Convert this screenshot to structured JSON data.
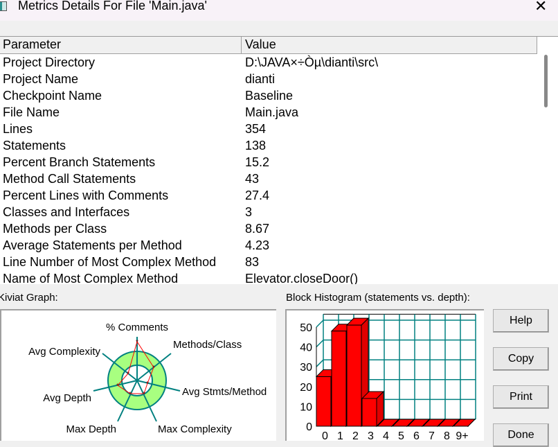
{
  "window": {
    "title": "Metrics Details For File 'Main.java'",
    "close_icon": "close-icon"
  },
  "table": {
    "headers": [
      "Parameter",
      "Value"
    ],
    "rows": [
      {
        "param": "Project Directory",
        "value": "D:\\JAVA×÷Òµ\\dianti\\src\\"
      },
      {
        "param": "Project Name",
        "value": "dianti"
      },
      {
        "param": "Checkpoint Name",
        "value": "Baseline"
      },
      {
        "param": "File Name",
        "value": "Main.java"
      },
      {
        "param": "Lines",
        "value": "354"
      },
      {
        "param": "Statements",
        "value": "138"
      },
      {
        "param": "Percent Branch Statements",
        "value": "15.2"
      },
      {
        "param": "Method Call Statements",
        "value": "43"
      },
      {
        "param": "Percent Lines with Comments",
        "value": "27.4"
      },
      {
        "param": "Classes and Interfaces",
        "value": "3"
      },
      {
        "param": "Methods per Class",
        "value": "8.67"
      },
      {
        "param": "Average Statements per Method",
        "value": "4.23"
      },
      {
        "param": "Line Number of Most Complex Method",
        "value": "83"
      },
      {
        "param": "Name of Most Complex Method",
        "value": "Elevator.closeDoor()"
      }
    ]
  },
  "kiviat": {
    "label": "Kiviat Graph:",
    "axes": [
      "% Comments",
      "Methods/Class",
      "Avg Stmts/Method",
      "Max Complexity",
      "Max Depth",
      "Avg Depth",
      "Avg Complexity"
    ],
    "ring_color": "#a8ff80",
    "axis_color": "#008080",
    "line_color": "#ff0000"
  },
  "chart_data": {
    "type": "bar",
    "title": "Block Histogram (statements vs. depth):",
    "categories": [
      "0",
      "1",
      "2",
      "3",
      "4",
      "5",
      "6",
      "7",
      "8",
      "9+"
    ],
    "values": [
      25,
      48,
      51,
      14,
      0,
      0,
      0,
      0,
      0,
      0
    ],
    "yticks": [
      "0",
      "10",
      "20",
      "30",
      "40",
      "50"
    ],
    "ylim": [
      0,
      50
    ],
    "grid": true,
    "bar_color": "#ff0000",
    "grid_color": "#008080"
  },
  "buttons": {
    "help": "Help",
    "copy": "Copy",
    "print": "Print",
    "done": "Done"
  }
}
